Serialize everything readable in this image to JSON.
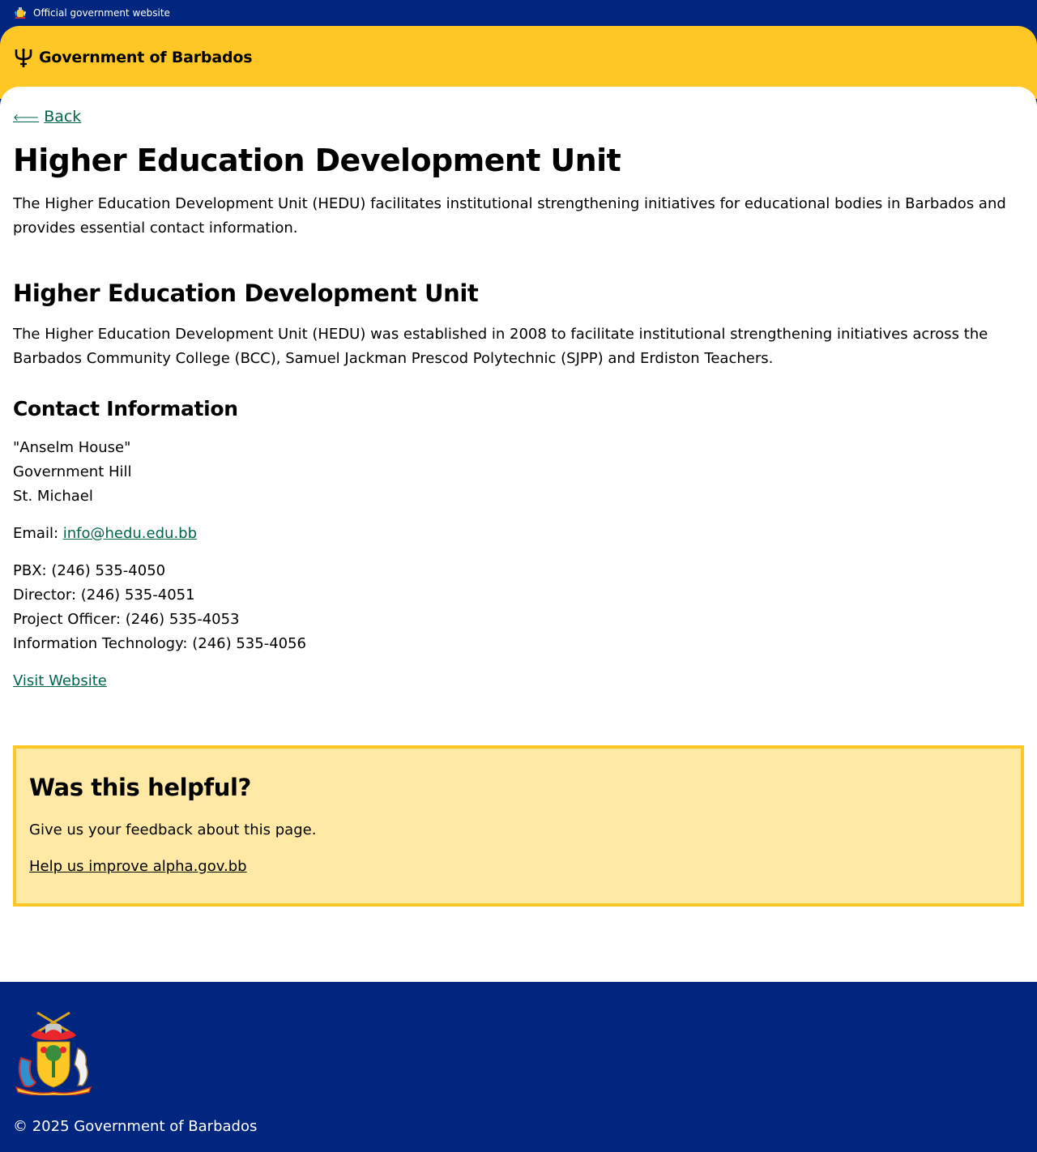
{
  "banner": {
    "text": "Official government website"
  },
  "header": {
    "brand_name": "Government of Barbados"
  },
  "nav": {
    "back_label": "Back"
  },
  "page": {
    "title": "Higher Education Development Unit",
    "intro": "The Higher Education Development Unit (HEDU) facilitates institutional strengthening initiatives for educational bodies in Barbados and provides essential contact information."
  },
  "section": {
    "title": "Higher Education Development Unit",
    "body": "The Higher Education Development Unit (HEDU) was established in 2008 to facilitate institutional strengthening initiatives across the Barbados Community College (BCC), Samuel Jackman Prescod Polytechnic (SJPP) and Erdiston Teachers."
  },
  "contact": {
    "title": "Contact Information",
    "address": [
      "\"Anselm House\"",
      "Government Hill",
      "St. Michael"
    ],
    "email_label": "Email: ",
    "email": "info@hedu.edu.bb",
    "phones": [
      "PBX: (246) 535-4050",
      "Director: (246) 535-4051",
      "Project Officer: (246) 535-4053",
      "Information Technology: (246) 535-4056"
    ],
    "website_label": "Visit Website"
  },
  "feedback": {
    "title": "Was this helpful?",
    "text": "Give us your feedback about this page.",
    "link": "Help us improve alpha.gov.bb"
  },
  "footer": {
    "copyright": "© 2025 Government of Barbados"
  },
  "colors": {
    "navy": "#00267f",
    "gold": "#ffc726",
    "feedback_bg": "#ffe9a5",
    "link_green": "#00654a"
  },
  "icons": {
    "banner": "coat-of-arms-icon",
    "brand": "trident-icon",
    "back": "arrow-left-icon",
    "footer": "coat-of-arms-icon"
  }
}
